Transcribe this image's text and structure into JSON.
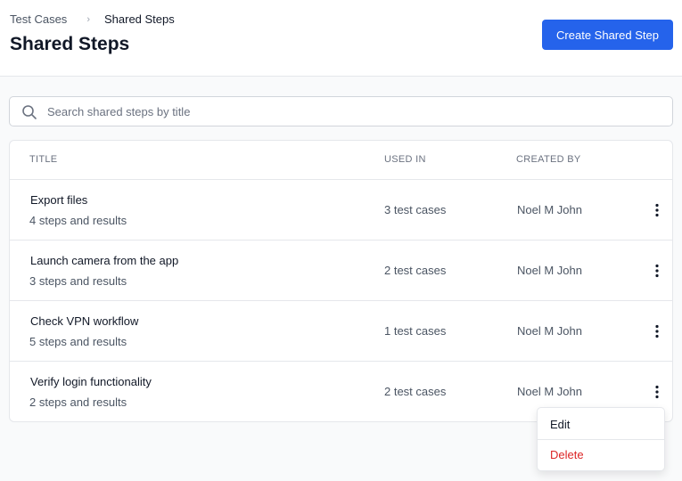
{
  "breadcrumb": {
    "parent": "Test Cases",
    "separator": "›",
    "current": "Shared Steps"
  },
  "page_title": "Shared Steps",
  "create_button_label": "Create Shared Step",
  "search": {
    "placeholder": "Search shared steps by title",
    "value": ""
  },
  "table": {
    "headers": {
      "title": "TITLE",
      "used_in": "USED IN",
      "created_by": "CREATED BY"
    },
    "rows": [
      {
        "title": "Export files",
        "subtitle": "4 steps and results",
        "used_in": "3 test cases",
        "created_by": "Noel M John"
      },
      {
        "title": "Launch camera from the app",
        "subtitle": "3 steps and results",
        "used_in": "2 test cases",
        "created_by": "Noel M John"
      },
      {
        "title": "Check VPN workflow",
        "subtitle": "5 steps and results",
        "used_in": "1 test cases",
        "created_by": "Noel M John"
      },
      {
        "title": "Verify login functionality",
        "subtitle": "2 steps and results",
        "used_in": "2 test cases",
        "created_by": "Noel M John"
      }
    ]
  },
  "row_menu": {
    "edit_label": "Edit",
    "delete_label": "Delete"
  },
  "icons": {
    "search": "search-icon",
    "row_actions": "more-vertical-icon"
  },
  "colors": {
    "primary": "#2563eb",
    "danger": "#dc2626",
    "text": "#111827",
    "muted": "#4b5563",
    "border": "#e5e7eb"
  }
}
